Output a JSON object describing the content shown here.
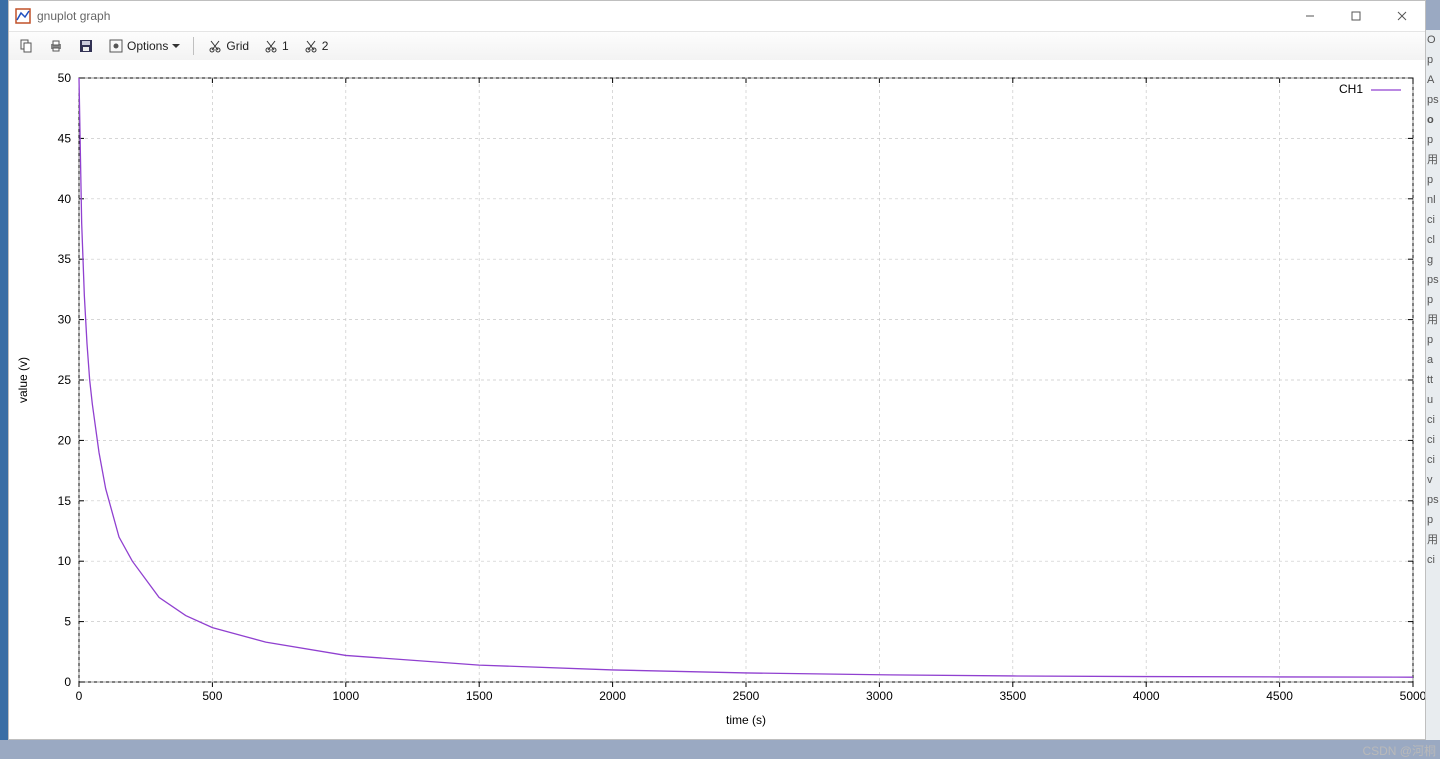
{
  "window": {
    "title": "gnuplot graph"
  },
  "toolbar": {
    "options_label": "Options",
    "grid_label": "Grid",
    "ruler1_label": "1",
    "ruler2_label": "2"
  },
  "chart_data": {
    "type": "line",
    "xlabel": "time (s)",
    "ylabel": "value (v)",
    "xlim": [
      0,
      5000
    ],
    "ylim": [
      0,
      50
    ],
    "xticks": [
      0,
      500,
      1000,
      1500,
      2000,
      2500,
      3000,
      3500,
      4000,
      4500,
      5000
    ],
    "yticks": [
      0,
      5,
      10,
      15,
      20,
      25,
      30,
      35,
      40,
      45,
      50
    ],
    "grid": true,
    "legend_position": "top-right",
    "series": [
      {
        "name": "CH1",
        "color": "#9040d0",
        "x": [
          0,
          10,
          20,
          30,
          40,
          50,
          75,
          100,
          150,
          200,
          300,
          400,
          500,
          700,
          1000,
          1500,
          2000,
          2500,
          3000,
          3500,
          4000,
          4500,
          5000
        ],
        "values": [
          50,
          38,
          32,
          28,
          25,
          23,
          19,
          16,
          12,
          10,
          7,
          5.5,
          4.5,
          3.3,
          2.2,
          1.4,
          1.0,
          0.75,
          0.6,
          0.5,
          0.45,
          0.42,
          0.4
        ]
      }
    ]
  },
  "watermark": "CSDN @河桐"
}
